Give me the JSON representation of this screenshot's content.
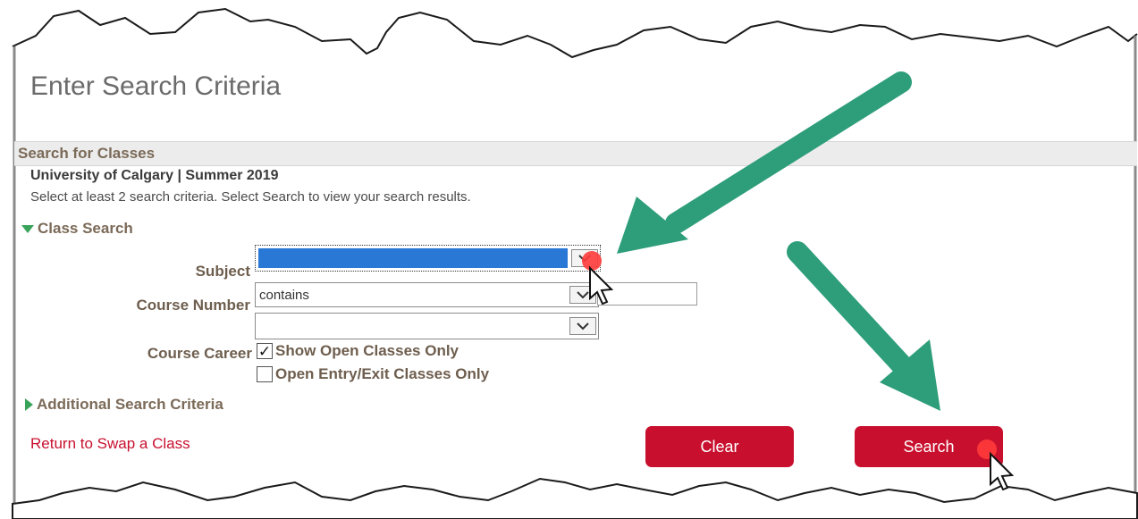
{
  "page": {
    "title": "Enter Search Criteria"
  },
  "section": {
    "header": "Search for Classes",
    "institution": "University of Calgary | Summer 2019",
    "instructions": "Select at least 2 search criteria. Select Search to view your search results."
  },
  "class_search": {
    "label": "Class Search",
    "subject": {
      "label": "Subject",
      "value": "",
      "chevron_icon": "chevron-down-icon"
    },
    "course_number": {
      "label": "Course Number",
      "operator": "contains",
      "value": ""
    },
    "course_career": {
      "label": "Course Career",
      "value": ""
    },
    "show_open_classes": {
      "label": "Show Open Classes Only",
      "checked": true,
      "mark": "✓"
    },
    "open_entry_exit": {
      "label": "Open Entry/Exit Classes Only",
      "checked": false
    }
  },
  "additional_search": {
    "label": "Additional Search Criteria"
  },
  "links": {
    "return_swap": "Return to Swap a Class"
  },
  "buttons": {
    "clear": "Clear",
    "search": "Search"
  },
  "colors": {
    "brand_red": "#c8102e",
    "arrow_green": "#2e9e7a",
    "section_header_bg": "#ececec",
    "selected_blue": "#2a78d6",
    "collapse_triangle": "#3aa35a"
  }
}
